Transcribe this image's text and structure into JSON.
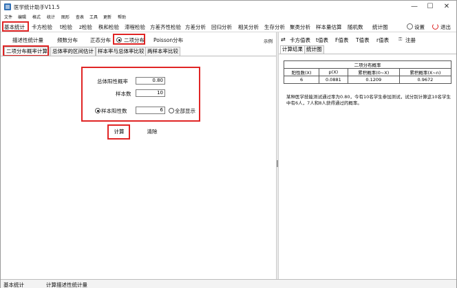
{
  "window": {
    "title": "医学统计助手V11.5",
    "minimize": "—",
    "maximize": "☐",
    "close": "✕"
  },
  "menu": [
    "文件",
    "编辑",
    "格式",
    "统计",
    "图形",
    "查表",
    "工具",
    "更新",
    "帮助"
  ],
  "toolbar": {
    "items": [
      "基本统计",
      "卡方检验",
      "t检验",
      "z检验",
      "秩和检验",
      "滞程检验",
      "方差齐性检验",
      "方差分析",
      "回归分析",
      "相关分析",
      "生存分析",
      "聚类分析",
      "样本量估算",
      "随机数",
      "统计图"
    ],
    "settings": "设置",
    "exit": "退出"
  },
  "subtoolbar": {
    "items": [
      "描述性统计量",
      "频数分布",
      "正态分布",
      "二项分布",
      "Poisson分布"
    ],
    "example": "示例"
  },
  "tabs": [
    "二项分布概率计算",
    "总体率的区间估计",
    "样本率与总体率比较",
    "两样本率比较"
  ],
  "form": {
    "prob_label": "总体阳性概率",
    "prob_value": "0.80",
    "n_label": "样本数",
    "n_value": "10",
    "k_label": "样本阳性数",
    "k_value": "6",
    "all_label": "全部显示",
    "calc_button": "计算",
    "clear_button": "清除"
  },
  "right_toolbar": {
    "items": [
      "卡方值表",
      "t值表",
      "F值表",
      "T值表",
      "r值表"
    ],
    "register": "注册"
  },
  "right_tabs": [
    "计算结果",
    "统计图"
  ],
  "result": {
    "title": "二项分布概率",
    "headers": [
      "阳性数(X)",
      "p(X)",
      "累积概率(0~X)",
      "累积概率(X~n)"
    ],
    "row": [
      "6",
      "0.0881",
      "0.1209",
      "0.9672"
    ],
    "example": "某种医学技能测试通过率为0.80，今有10名学生参加测试，试分别计算这10名学生中有6人，7人和8人获得通过的概率。"
  },
  "status": {
    "left": "基本统计",
    "right": "计算描述性统计量"
  },
  "colors": {
    "highlight": "#e02424",
    "accent": "#2f6fb5"
  }
}
